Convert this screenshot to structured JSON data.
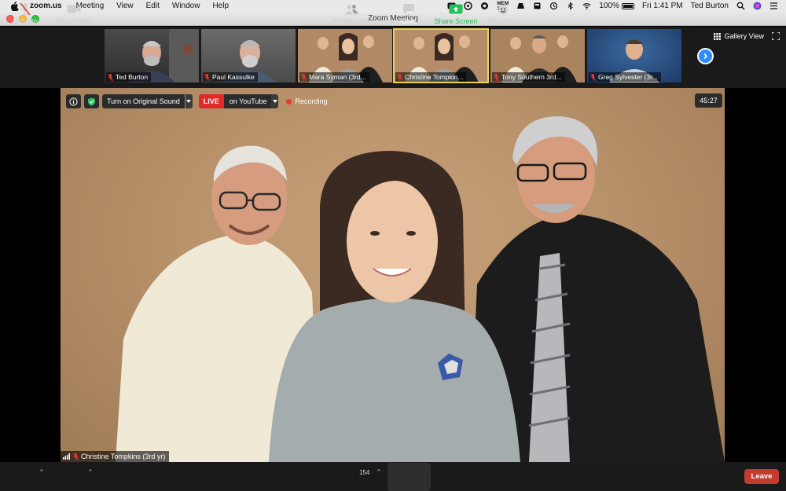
{
  "menubar": {
    "app_name": "zoom.us",
    "menus": [
      "Meeting",
      "View",
      "Edit",
      "Window",
      "Help"
    ],
    "mem_label": "MEM",
    "mem_value": "75%",
    "battery": "100%",
    "datetime": "Fri 1:41 PM",
    "user": "Ted Burton"
  },
  "window": {
    "title": "Zoom Meeting"
  },
  "gallery": {
    "view_label": "Gallery View",
    "thumbnails": [
      {
        "name": "Ted Burton"
      },
      {
        "name": "Paul Kassulke"
      },
      {
        "name": "Mara Syman (3rd..."
      },
      {
        "name": "Christine Tompkin..."
      },
      {
        "name": "Tony Southern 3rd..."
      },
      {
        "name": "Greg Sylvester (3r..."
      }
    ]
  },
  "stage": {
    "original_sound_label": "Turn on Original Sound",
    "live_label": "LIVE",
    "youtube_label": "on YouTube",
    "recording_label": "Recording",
    "timer": "45:27",
    "active_speaker": "Christine Tompkins (3rd yr)"
  },
  "toolbar": {
    "unmute": "Unmute",
    "stop_video": "Stop Video",
    "participants": "Participants",
    "participant_count": "154",
    "chat": "Chat",
    "share_screen": "Share Screen",
    "reactions": "Reactions",
    "leave": "Leave"
  },
  "colors": {
    "accent_blue": "#2d8cff",
    "leave_red": "#c23b2c",
    "live_red": "#e02828",
    "share_green": "#23c05a",
    "active_outline": "#e7d35a"
  }
}
